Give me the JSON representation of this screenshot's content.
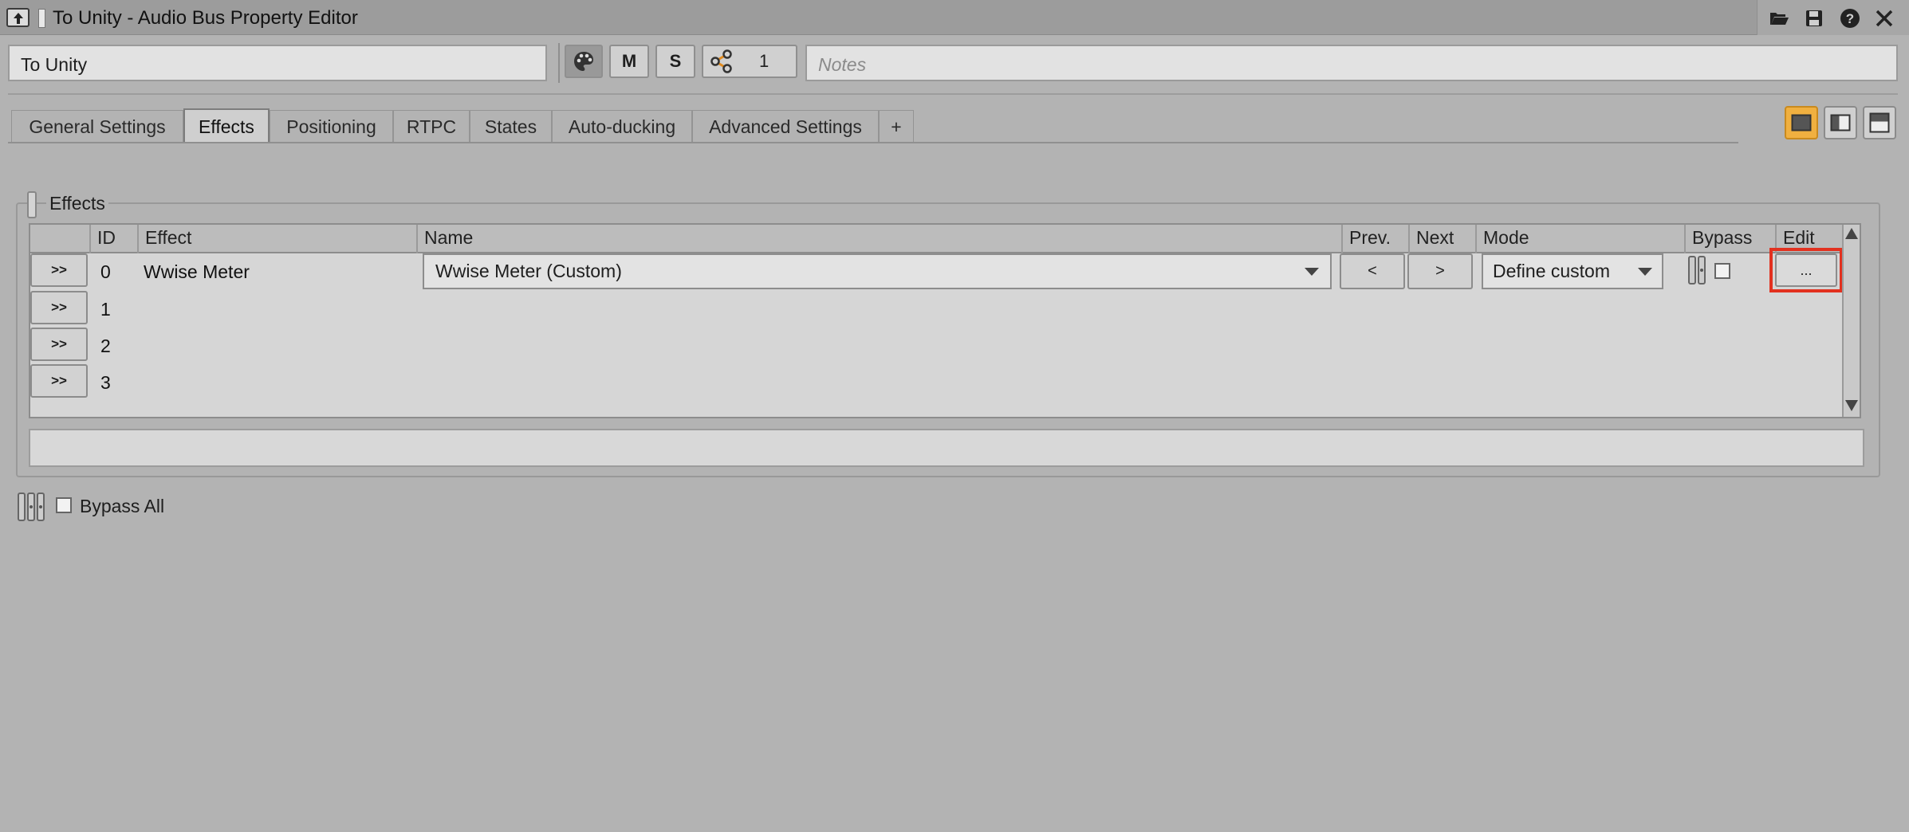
{
  "window": {
    "title": "To Unity - Audio Bus Property Editor"
  },
  "name_row": {
    "object_name": "To Unity",
    "mute_label": "M",
    "solo_label": "S",
    "share_count": "1",
    "notes_placeholder": "Notes"
  },
  "tabs": [
    {
      "label": "General Settings"
    },
    {
      "label": "Effects",
      "active": true
    },
    {
      "label": "Positioning"
    },
    {
      "label": "RTPC"
    },
    {
      "label": "States"
    },
    {
      "label": "Auto-ducking"
    },
    {
      "label": "Advanced Settings"
    },
    {
      "label": "+"
    }
  ],
  "effects": {
    "group_label": "Effects",
    "columns": {
      "id": "ID",
      "effect": "Effect",
      "name": "Name",
      "prev": "Prev.",
      "next": "Next",
      "mode": "Mode",
      "bypass": "Bypass",
      "edit": "Edit"
    },
    "row_button_label": ">>",
    "rows": [
      {
        "id": "0",
        "effect": "Wwise Meter",
        "name": "Wwise Meter (Custom)",
        "prev": "<",
        "next": ">",
        "mode": "Define custom",
        "edit": "..."
      },
      {
        "id": "1"
      },
      {
        "id": "2"
      },
      {
        "id": "3"
      }
    ],
    "bypass_all_label": "Bypass All"
  },
  "colors": {
    "background": "#b3b3b3",
    "accent_orange": "#f0b040",
    "highlight_red": "#e2311f"
  },
  "icons": [
    "view-icon",
    "folder-open-icon",
    "save-icon",
    "help-icon",
    "close-icon",
    "color-palette-icon",
    "share-icon",
    "layout-single-icon",
    "layout-split-vertical-icon",
    "layout-split-horizontal-icon"
  ]
}
